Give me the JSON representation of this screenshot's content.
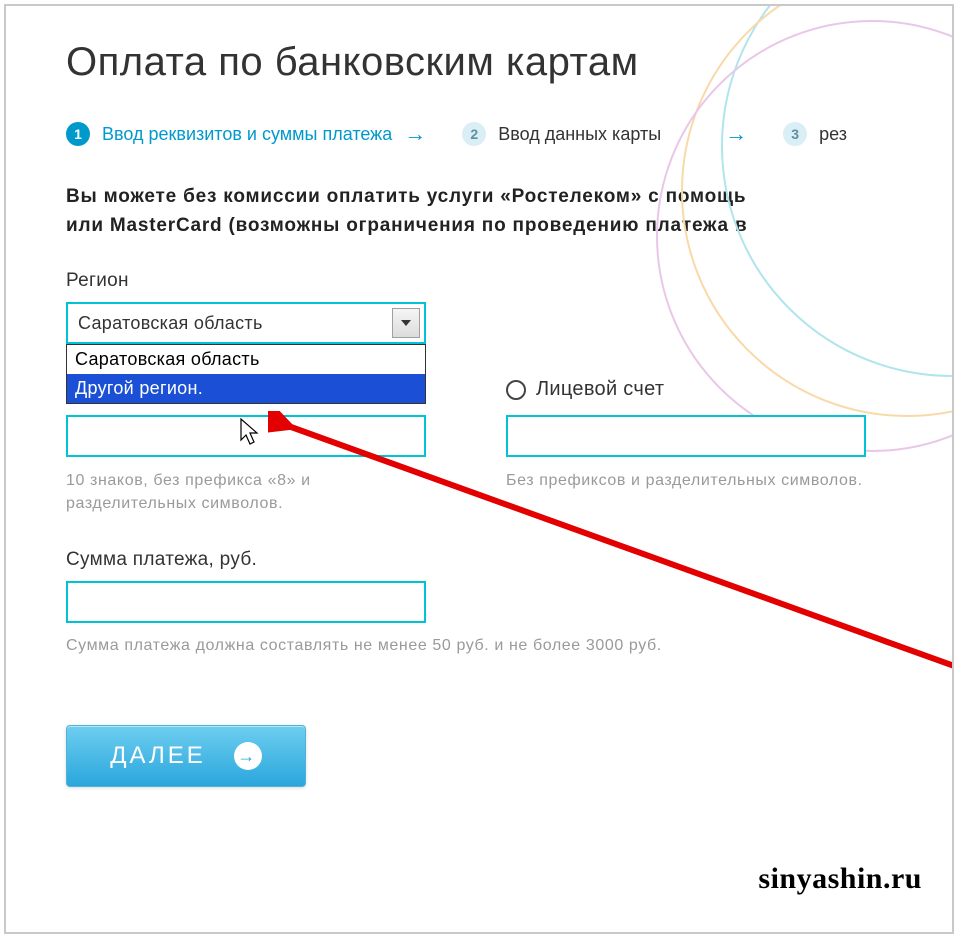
{
  "title": "Оплата по банковским картам",
  "steps": {
    "s1": {
      "num": "1",
      "label": "Ввод реквизитов и суммы платежа"
    },
    "s2": {
      "num": "2",
      "label": "Ввод данных карты"
    },
    "s3": {
      "num": "3",
      "label": "рез"
    }
  },
  "intro_line1": "Вы можете без комиссии оплатить услуги «Ростелеком» с помощь",
  "intro_line2": "или MasterCard (возможны ограничения по проведению платежа в",
  "region": {
    "label": "Регион",
    "selected": "Саратовская область",
    "options": [
      "Саратовская область",
      "Другой регион."
    ]
  },
  "account": {
    "label": "Лицевой счет",
    "hint": "Без префиксов и разделительных символов."
  },
  "phone": {
    "hint": "10 знаков, без префикса «8» и разделительных символов."
  },
  "amount": {
    "label": "Сумма платежа, руб.",
    "hint": "Сумма платежа должна составлять не менее 50 руб. и не более 3000 руб."
  },
  "next_button": "ДАЛЕЕ",
  "watermark": "sinyashin.ru"
}
